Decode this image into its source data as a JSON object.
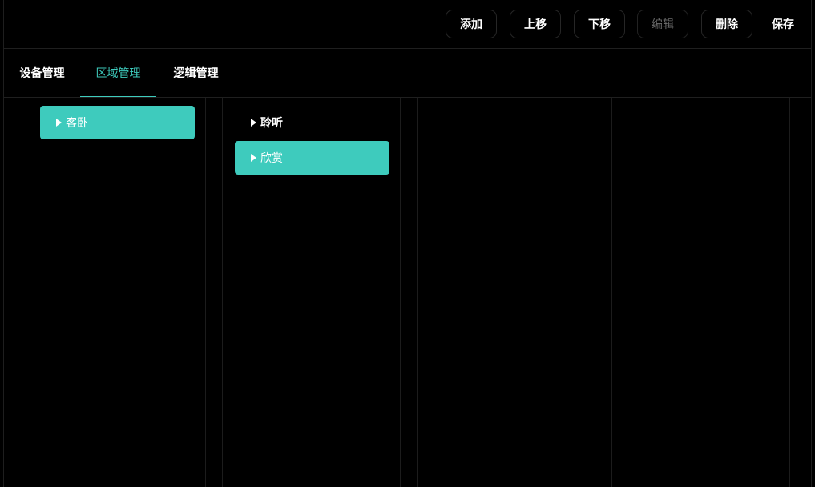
{
  "toolbar": {
    "add_label": "添加",
    "move_up_label": "上移",
    "move_down_label": "下移",
    "edit_label": "编辑",
    "delete_label": "删除",
    "save_label": "保存"
  },
  "tabs": [
    {
      "label": "设备管理"
    },
    {
      "label": "区域管理"
    },
    {
      "label": "逻辑管理"
    }
  ],
  "active_tab": "区域管理",
  "columns": [
    {
      "items": [
        {
          "label": "客卧",
          "selected": true
        }
      ]
    },
    {
      "items": [
        {
          "label": "聆听",
          "selected": false
        },
        {
          "label": "欣赏",
          "selected": true
        }
      ]
    },
    {
      "items": []
    },
    {
      "items": []
    }
  ],
  "colors": {
    "accent": "#3ecbbd",
    "background": "#000000",
    "border": "#262626",
    "disabled_text": "#6b6b6b"
  },
  "icons": {
    "tree_item": "caret-right-icon"
  }
}
